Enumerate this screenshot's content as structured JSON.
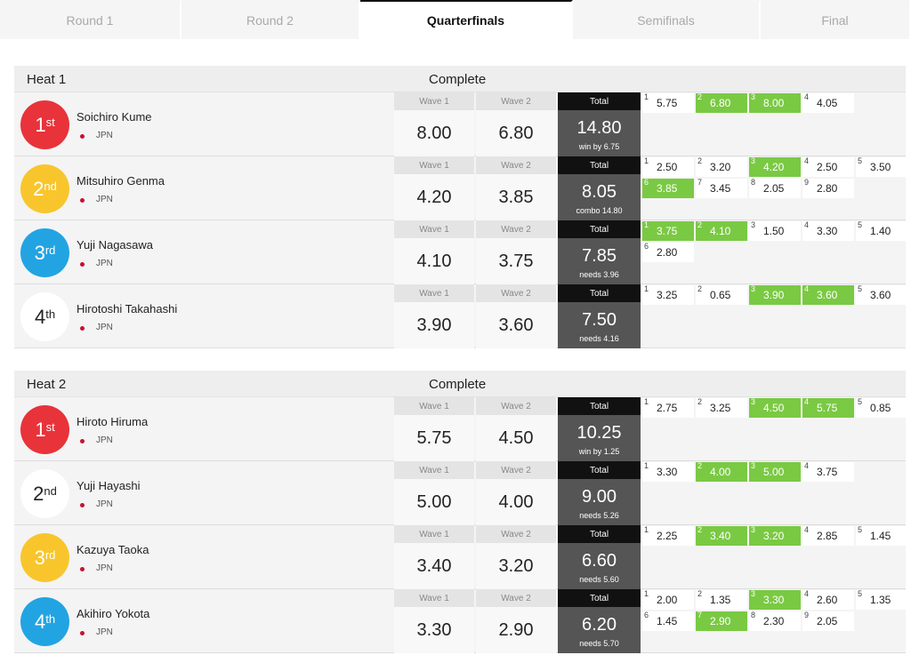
{
  "tabs": [
    {
      "label": "Round 1",
      "active": false
    },
    {
      "label": "Round 2",
      "active": false
    },
    {
      "label": "Quarterfinals",
      "active": true
    },
    {
      "label": "Semifinals",
      "active": false
    },
    {
      "label": "Final",
      "active": false
    }
  ],
  "column_labels": {
    "wave1": "Wave 1",
    "wave2": "Wave 2",
    "total": "Total"
  },
  "colors": {
    "first": "#e8333a",
    "second_yellow": "#f8c62c",
    "third_blue": "#22a4e3",
    "white": "#ffffff",
    "counting_wave": "#7ac943"
  },
  "heats": [
    {
      "title": "Heat 1",
      "status": "Complete",
      "surfers": [
        {
          "place_num": "1",
          "place_sfx": "st",
          "color": "red",
          "name": "Soichiro Kume",
          "country": "JPN",
          "wave1": "8.00",
          "wave2": "6.80",
          "total": "14.80",
          "note": "win by 6.75",
          "waves": [
            {
              "n": "1",
              "v": "5.75",
              "c": false
            },
            {
              "n": "2",
              "v": "6.80",
              "c": true
            },
            {
              "n": "3",
              "v": "8.00",
              "c": true
            },
            {
              "n": "4",
              "v": "4.05",
              "c": false
            }
          ]
        },
        {
          "place_num": "2",
          "place_sfx": "nd",
          "color": "yellow",
          "name": "Mitsuhiro Genma",
          "country": "JPN",
          "wave1": "4.20",
          "wave2": "3.85",
          "total": "8.05",
          "note": "combo 14.80",
          "waves": [
            {
              "n": "1",
              "v": "2.50",
              "c": false
            },
            {
              "n": "2",
              "v": "3.20",
              "c": false
            },
            {
              "n": "3",
              "v": "4.20",
              "c": true
            },
            {
              "n": "4",
              "v": "2.50",
              "c": false
            },
            {
              "n": "5",
              "v": "3.50",
              "c": false
            },
            {
              "n": "6",
              "v": "3.85",
              "c": true
            },
            {
              "n": "7",
              "v": "3.45",
              "c": false
            },
            {
              "n": "8",
              "v": "2.05",
              "c": false
            },
            {
              "n": "9",
              "v": "2.80",
              "c": false
            }
          ]
        },
        {
          "place_num": "3",
          "place_sfx": "rd",
          "color": "blue",
          "name": "Yuji Nagasawa",
          "country": "JPN",
          "wave1": "4.10",
          "wave2": "3.75",
          "total": "7.85",
          "note": "needs 3.96",
          "waves": [
            {
              "n": "1",
              "v": "3.75",
              "c": true
            },
            {
              "n": "2",
              "v": "4.10",
              "c": true
            },
            {
              "n": "3",
              "v": "1.50",
              "c": false
            },
            {
              "n": "4",
              "v": "3.30",
              "c": false
            },
            {
              "n": "5",
              "v": "1.40",
              "c": false
            },
            {
              "n": "6",
              "v": "2.80",
              "c": false
            }
          ]
        },
        {
          "place_num": "4",
          "place_sfx": "th",
          "color": "white",
          "name": "Hirotoshi Takahashi",
          "country": "JPN",
          "wave1": "3.90",
          "wave2": "3.60",
          "total": "7.50",
          "note": "needs 4.16",
          "waves": [
            {
              "n": "1",
              "v": "3.25",
              "c": false
            },
            {
              "n": "2",
              "v": "0.65",
              "c": false
            },
            {
              "n": "3",
              "v": "3.90",
              "c": true
            },
            {
              "n": "4",
              "v": "3.60",
              "c": true
            },
            {
              "n": "5",
              "v": "3.60",
              "c": false
            }
          ]
        }
      ]
    },
    {
      "title": "Heat 2",
      "status": "Complete",
      "surfers": [
        {
          "place_num": "1",
          "place_sfx": "st",
          "color": "red",
          "name": "Hiroto Hiruma",
          "country": "JPN",
          "wave1": "5.75",
          "wave2": "4.50",
          "total": "10.25",
          "note": "win by 1.25",
          "waves": [
            {
              "n": "1",
              "v": "2.75",
              "c": false
            },
            {
              "n": "2",
              "v": "3.25",
              "c": false
            },
            {
              "n": "3",
              "v": "4.50",
              "c": true
            },
            {
              "n": "4",
              "v": "5.75",
              "c": true
            },
            {
              "n": "5",
              "v": "0.85",
              "c": false
            }
          ]
        },
        {
          "place_num": "2",
          "place_sfx": "nd",
          "color": "white",
          "name": "Yuji Hayashi",
          "country": "JPN",
          "wave1": "5.00",
          "wave2": "4.00",
          "total": "9.00",
          "note": "needs 5.26",
          "waves": [
            {
              "n": "1",
              "v": "3.30",
              "c": false
            },
            {
              "n": "2",
              "v": "4.00",
              "c": true
            },
            {
              "n": "3",
              "v": "5.00",
              "c": true
            },
            {
              "n": "4",
              "v": "3.75",
              "c": false
            }
          ]
        },
        {
          "place_num": "3",
          "place_sfx": "rd",
          "color": "yellow",
          "name": "Kazuya Taoka",
          "country": "JPN",
          "wave1": "3.40",
          "wave2": "3.20",
          "total": "6.60",
          "note": "needs 5.60",
          "waves": [
            {
              "n": "1",
              "v": "2.25",
              "c": false
            },
            {
              "n": "2",
              "v": "3.40",
              "c": true
            },
            {
              "n": "3",
              "v": "3.20",
              "c": true
            },
            {
              "n": "4",
              "v": "2.85",
              "c": false
            },
            {
              "n": "5",
              "v": "1.45",
              "c": false
            }
          ]
        },
        {
          "place_num": "4",
          "place_sfx": "th",
          "color": "blue",
          "name": "Akihiro Yokota",
          "country": "JPN",
          "wave1": "3.30",
          "wave2": "2.90",
          "total": "6.20",
          "note": "needs 5.70",
          "waves": [
            {
              "n": "1",
              "v": "2.00",
              "c": false
            },
            {
              "n": "2",
              "v": "1.35",
              "c": false
            },
            {
              "n": "3",
              "v": "3.30",
              "c": true
            },
            {
              "n": "4",
              "v": "2.60",
              "c": false
            },
            {
              "n": "5",
              "v": "1.35",
              "c": false
            },
            {
              "n": "6",
              "v": "1.45",
              "c": false
            },
            {
              "n": "7",
              "v": "2.90",
              "c": true
            },
            {
              "n": "8",
              "v": "2.30",
              "c": false
            },
            {
              "n": "9",
              "v": "2.05",
              "c": false
            }
          ]
        }
      ]
    }
  ]
}
